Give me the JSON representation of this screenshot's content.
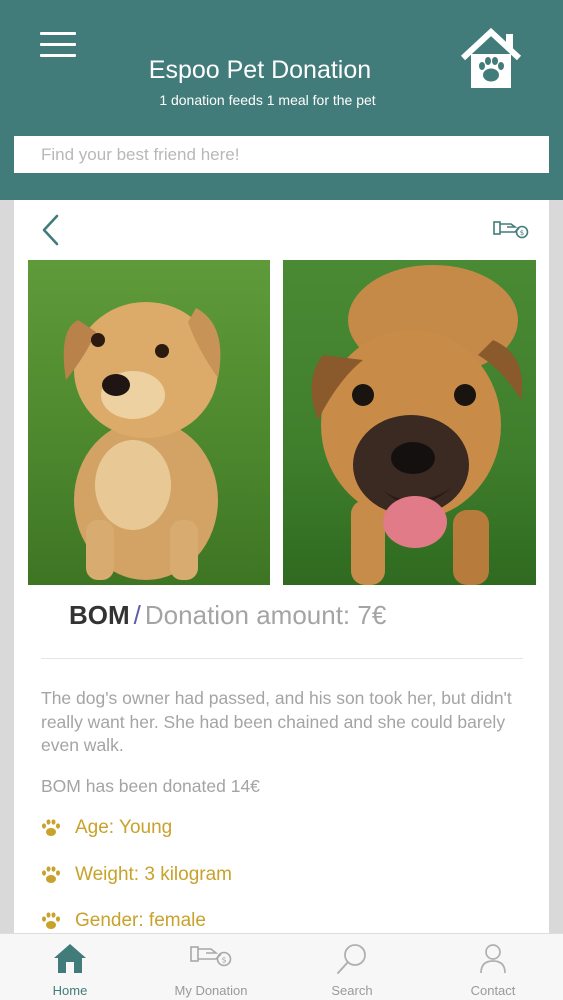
{
  "header": {
    "title": "Espoo Pet Donation",
    "subtitle": "1 donation feeds 1 meal for the pet",
    "menu_icon": "hamburger-menu-icon",
    "logo_icon": "home-paw-icon",
    "background_color": "#427c7a"
  },
  "search": {
    "placeholder": "Find your best friend here!",
    "value": ""
  },
  "detail": {
    "back_icon": "chevron-left-icon",
    "donate_icon": "hand-coin-icon",
    "photos": [
      "dog-photo",
      "dog-photo"
    ],
    "pet_name": "BOM",
    "separator": "/",
    "donation_amount": "Donation amount: 7€",
    "description": "The dog's owner had passed, and his son took her, but didn't really want her. She had been chained and she could barely even walk.",
    "donated_total": "BOM has been donated 14€",
    "attributes": [
      {
        "icon": "paw-icon",
        "text": "Age: Young"
      },
      {
        "icon": "paw-icon",
        "text": "Weight: 3 kilogram"
      },
      {
        "icon": "paw-icon",
        "text": "Gender: female"
      }
    ],
    "accent_color": "#c8a22a"
  },
  "bottom_nav": {
    "items": [
      {
        "label": "Home",
        "icon": "home-icon",
        "active": true
      },
      {
        "label": "My Donation",
        "icon": "hand-coin-icon",
        "active": false
      },
      {
        "label": "Search",
        "icon": "search-icon",
        "active": false
      },
      {
        "label": "Contact",
        "icon": "person-icon",
        "active": false
      }
    ],
    "active_color": "#427c7a"
  }
}
